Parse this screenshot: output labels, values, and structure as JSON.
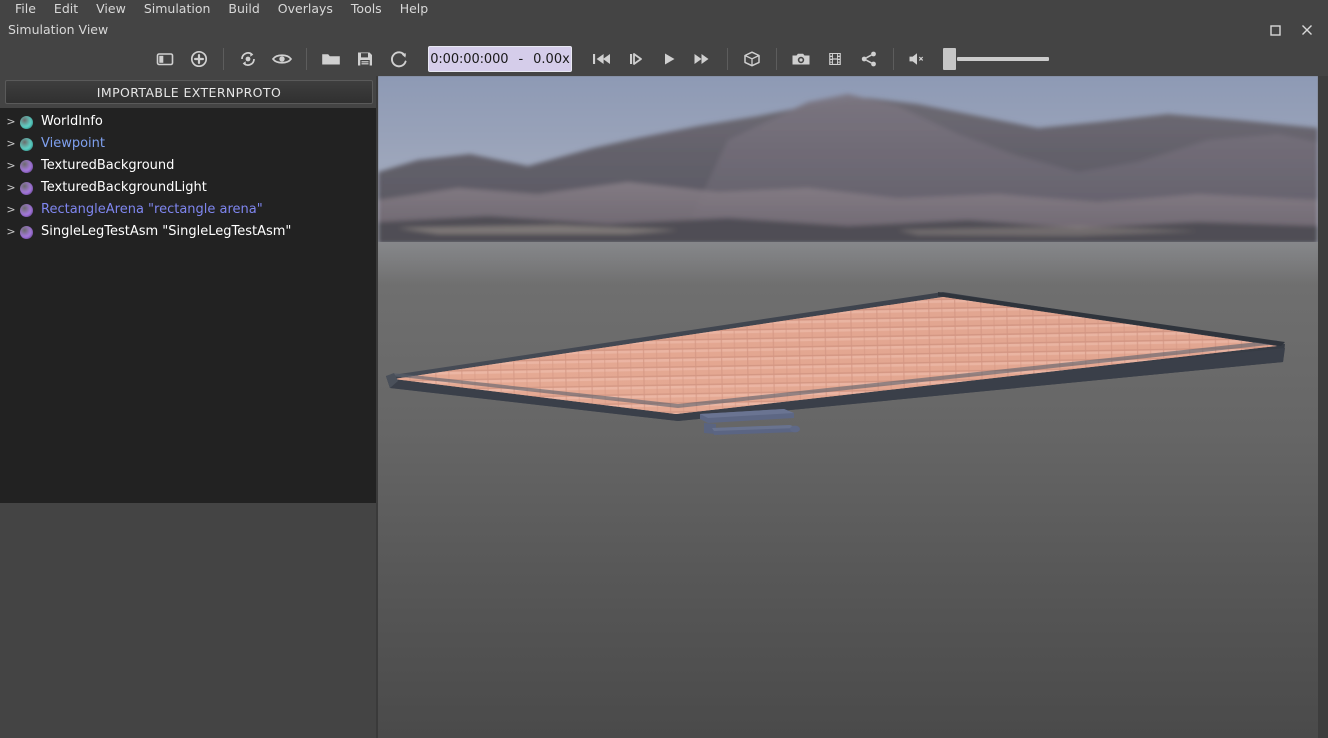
{
  "app": {
    "title": "Simulation View",
    "background_color": "#444444",
    "panel_color": "#222222"
  },
  "menubar": {
    "items": [
      {
        "label": "File"
      },
      {
        "label": "Edit"
      },
      {
        "label": "View"
      },
      {
        "label": "Simulation"
      },
      {
        "label": "Build"
      },
      {
        "label": "Overlays"
      },
      {
        "label": "Tools"
      },
      {
        "label": "Help"
      }
    ]
  },
  "window_controls": {
    "maximize": "maximize-icon",
    "close": "close-icon"
  },
  "tab": {
    "label": "Simulation View"
  },
  "toolbar": {
    "icons": [
      {
        "name": "toggle-sidebar-icon",
        "tooltip": "Toggle sidebar"
      },
      {
        "name": "add-node-icon",
        "tooltip": "Add a node"
      },
      {
        "name": "transform-node-icon",
        "tooltip": "Transform node"
      },
      {
        "name": "view-node-icon",
        "tooltip": "View node"
      },
      {
        "name": "open-world-icon",
        "tooltip": "Open world"
      },
      {
        "name": "save-world-icon",
        "tooltip": "Save world"
      },
      {
        "name": "reload-world-icon",
        "tooltip": "Reload world"
      },
      {
        "name": "rewind-icon",
        "tooltip": "Reset simulation"
      },
      {
        "name": "step-icon",
        "tooltip": "Step"
      },
      {
        "name": "play-icon",
        "tooltip": "Run"
      },
      {
        "name": "fast-forward-icon",
        "tooltip": "Fast"
      },
      {
        "name": "render-3d-icon",
        "tooltip": "3D rendering"
      },
      {
        "name": "screenshot-icon",
        "tooltip": "Take screenshot"
      },
      {
        "name": "movie-icon",
        "tooltip": "Make movie"
      },
      {
        "name": "share-icon",
        "tooltip": "Share"
      },
      {
        "name": "mute-icon",
        "tooltip": "Sound muted"
      }
    ],
    "time_display": {
      "time": "0:00:00:000",
      "separator": "-",
      "speed": "0.00x",
      "background_color": "#d5cdea"
    },
    "volume": {
      "value": 0,
      "muted": true
    }
  },
  "left_panel": {
    "header": "IMPORTABLE EXTERNPROTO",
    "tree": {
      "items": [
        {
          "arrow": ">",
          "bullet_color": "#5fe3d7",
          "label": "WorldInfo",
          "text_color": "#ffffff"
        },
        {
          "arrow": ">",
          "bullet_color": "#5fe3d7",
          "label": "Viewpoint",
          "text_color": "#7fa0ef"
        },
        {
          "arrow": ">",
          "bullet_color": "#b07df0",
          "label": "TexturedBackground",
          "text_color": "#ffffff"
        },
        {
          "arrow": ">",
          "bullet_color": "#b07df0",
          "label": "TexturedBackgroundLight",
          "text_color": "#ffffff"
        },
        {
          "arrow": ">",
          "bullet_color": "#b07df0",
          "label": "RectangleArena \"rectangle arena\"",
          "text_color": "#7f86ef"
        },
        {
          "arrow": ">",
          "bullet_color": "#b07df0",
          "label": "SingleLegTestAsm \"SingleLegTestAsm\"",
          "text_color": "#ffffff"
        }
      ]
    }
  },
  "viewport": {
    "description": "3D simulation view with blurred mountain panorama background, a rectangular arena with salmon tiled floor, and a small blue-gray robot assembly",
    "sky_color": "#98a2b9",
    "ground_color": "#6b6b6b",
    "arena_floor_color": "#e3a58f",
    "arena_wall_color": "#3f444f",
    "robot_color": "#5a6584"
  }
}
